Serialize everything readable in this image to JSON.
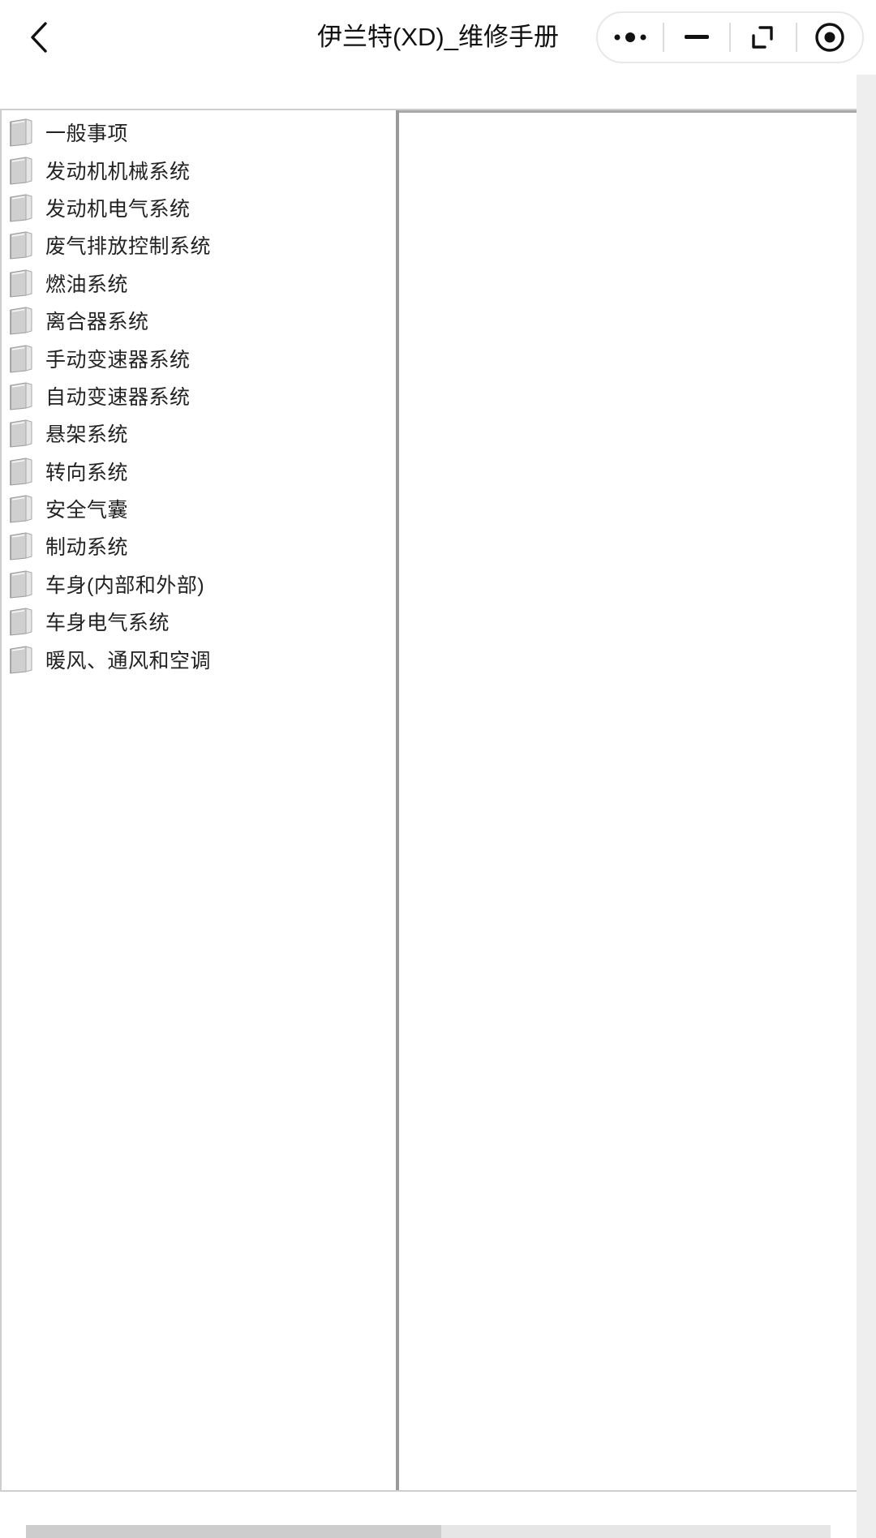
{
  "header": {
    "title": "伊兰特(XD)_维修手册",
    "back_icon": "chevron-left-icon",
    "capsule": [
      "more-dots-icon",
      "minimize-icon",
      "restore-window-icon",
      "close-circle-icon"
    ]
  },
  "tree": {
    "items": [
      {
        "label": "一般事项"
      },
      {
        "label": "发动机机械系统"
      },
      {
        "label": "发动机电气系统"
      },
      {
        "label": "废气排放控制系统"
      },
      {
        "label": "燃油系统"
      },
      {
        "label": "离合器系统"
      },
      {
        "label": "手动变速器系统"
      },
      {
        "label": "自动变速器系统"
      },
      {
        "label": "悬架系统"
      },
      {
        "label": "转向系统"
      },
      {
        "label": "安全气囊"
      },
      {
        "label": "制动系统"
      },
      {
        "label": "车身(内部和外部)"
      },
      {
        "label": "车身电气系统"
      },
      {
        "label": "暖风、通风和空调"
      }
    ],
    "item_icon": "book-icon"
  },
  "colors": {
    "divider": "#9a9a9a",
    "border": "#cfcfcf",
    "scrollbar_track": "#eeeeee"
  }
}
